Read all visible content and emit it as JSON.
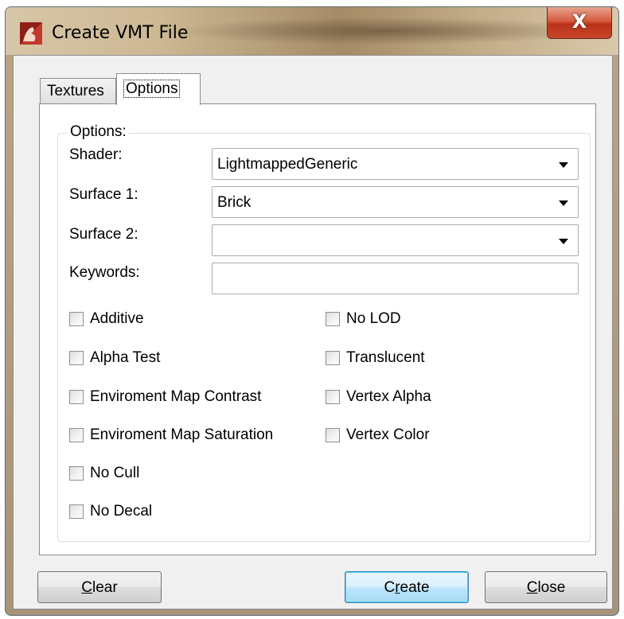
{
  "window": {
    "title": "Create VMT File",
    "close_glyph": "X",
    "app_icon": "app-icon"
  },
  "tabs": [
    {
      "label": "Textures",
      "active": false
    },
    {
      "label": "Options",
      "active": true
    }
  ],
  "options": {
    "group_label": "Options:",
    "shader": {
      "label": "Shader:",
      "value": "LightmappedGeneric"
    },
    "surface1": {
      "label": "Surface 1:",
      "value": "Brick"
    },
    "surface2": {
      "label": "Surface 2:",
      "value": ""
    },
    "keywords": {
      "label": "Keywords:",
      "value": ""
    },
    "checkboxes_left": [
      {
        "label": "Additive",
        "checked": false
      },
      {
        "label": "Alpha Test",
        "checked": false
      },
      {
        "label": "Enviroment Map Contrast",
        "checked": false
      },
      {
        "label": "Enviroment Map Saturation",
        "checked": false
      },
      {
        "label": "No Cull",
        "checked": false
      },
      {
        "label": "No Decal",
        "checked": false
      }
    ],
    "checkboxes_right": [
      {
        "label": "No LOD",
        "checked": false
      },
      {
        "label": "Translucent",
        "checked": false
      },
      {
        "label": "Vertex Alpha",
        "checked": false
      },
      {
        "label": "Vertex Color",
        "checked": false
      }
    ]
  },
  "buttons": {
    "clear": {
      "underline": "C",
      "rest": "lear"
    },
    "create": {
      "prefix": "C",
      "underline": "r",
      "rest": "eate"
    },
    "close": {
      "underline": "C",
      "rest": "lose"
    }
  },
  "colors": {
    "primary_button": "#bee6fd",
    "close_button": "#c9462a"
  }
}
